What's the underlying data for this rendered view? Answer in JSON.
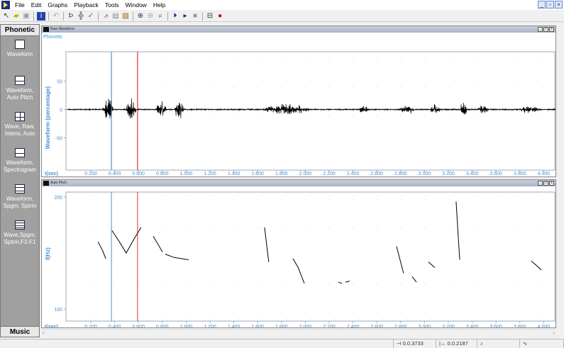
{
  "menu": [
    "File",
    "Edit",
    "Graphs",
    "Playback",
    "Tools",
    "Window",
    "Help"
  ],
  "window_buttons": [
    "_",
    "▫",
    "×"
  ],
  "sidebar": {
    "header": "Phonetic",
    "footer": "Music",
    "items": [
      {
        "label": "Waveform",
        "icon": "single-panel-icon"
      },
      {
        "label": "Waveform, Auto Pitch",
        "icon": "two-panel-icon"
      },
      {
        "label": "Wave, Raw, Intens, Auto",
        "icon": "four-panel-icon"
      },
      {
        "label": "Waveform, Spectrogram",
        "icon": "two-panel-icon"
      },
      {
        "label": "Waveform, Spgm, Sptrm",
        "icon": "three-panel-icon"
      },
      {
        "label": "Wave,Spgm, Sptrm,F2-F1",
        "icon": "four-row-panel-icon"
      }
    ]
  },
  "panes": [
    {
      "title": "Raw Waveform",
      "tab": "Phonetic",
      "ylabel": "Waveform (percentage)",
      "yticks": [
        "50",
        "0",
        "-50"
      ],
      "xlabel": "t(sec)"
    },
    {
      "title": "Auto Pitch",
      "ylabel": "f(Hz)",
      "yticks": [
        "200",
        "100"
      ],
      "xlabel": "t(sec)"
    }
  ],
  "xticks": [
    "0.200",
    "0.400",
    "0.600",
    "0.800",
    "1.000",
    "1.200",
    "1.400",
    "1.600",
    "1.800",
    "2.000",
    "2.200",
    "2.400",
    "2.600",
    "2.800",
    "3.000",
    "3.200",
    "3.400",
    "3.600",
    "3.800",
    "4.000"
  ],
  "cursors": {
    "left_sec": 0.3733,
    "right_sec": 0.592,
    "left_color": "#4a90d0",
    "right_color": "#e03030"
  },
  "status": {
    "cursor_pos": "0.0.3733",
    "cursor_delta": "0.0.2187"
  },
  "chart_data": [
    {
      "type": "line",
      "title": "Raw Waveform",
      "xlabel": "t(sec)",
      "ylabel": "Waveform (percentage)",
      "xlim": [
        0,
        4.1
      ],
      "ylim": [
        -100,
        100
      ],
      "envelope": [
        [
          0.3,
          0.45,
          30
        ],
        [
          0.5,
          0.65,
          25
        ],
        [
          0.75,
          0.9,
          20
        ],
        [
          0.9,
          1.05,
          18
        ],
        [
          1.65,
          2.35,
          12
        ],
        [
          2.45,
          2.6,
          8
        ],
        [
          2.8,
          3.0,
          12
        ],
        [
          3.05,
          3.2,
          10
        ],
        [
          3.3,
          3.4,
          18
        ],
        [
          3.45,
          3.6,
          10
        ],
        [
          3.8,
          4.1,
          8
        ]
      ]
    },
    {
      "type": "line",
      "title": "Auto Pitch",
      "xlabel": "t(sec)",
      "ylabel": "f(Hz)",
      "xlim": [
        0,
        4.1
      ],
      "ylim": [
        100,
        200
      ],
      "segments": [
        [
          [
            0.26,
            160
          ],
          [
            0.3,
            152
          ],
          [
            0.325,
            145
          ]
        ],
        [
          [
            0.378,
            170
          ],
          [
            0.44,
            160
          ],
          [
            0.497,
            150
          ],
          [
            0.56,
            162
          ],
          [
            0.622,
            173
          ]
        ],
        [
          [
            0.724,
            165
          ],
          [
            0.801,
            151
          ]
        ],
        [
          [
            0.825,
            149
          ],
          [
            0.9,
            146
          ],
          [
            1.021,
            144
          ]
        ],
        [
          [
            1.658,
            173
          ],
          [
            1.693,
            142
          ]
        ],
        [
          [
            1.896,
            145
          ],
          [
            1.94,
            137
          ],
          [
            1.991,
            123
          ]
        ],
        [
          [
            2.277,
            124
          ],
          [
            2.307,
            123
          ]
        ],
        [
          [
            2.336,
            124
          ],
          [
            2.372,
            125
          ]
        ],
        [
          [
            2.765,
            156
          ],
          [
            2.824,
            132
          ]
        ],
        [
          [
            2.896,
            129
          ],
          [
            2.932,
            124
          ]
        ],
        [
          [
            3.033,
            142
          ],
          [
            3.086,
            137
          ]
        ],
        [
          [
            3.265,
            196
          ],
          [
            3.28,
            170
          ],
          [
            3.295,
            144
          ]
        ],
        [
          [
            3.896,
            143
          ],
          [
            3.98,
            135
          ]
        ]
      ]
    }
  ]
}
